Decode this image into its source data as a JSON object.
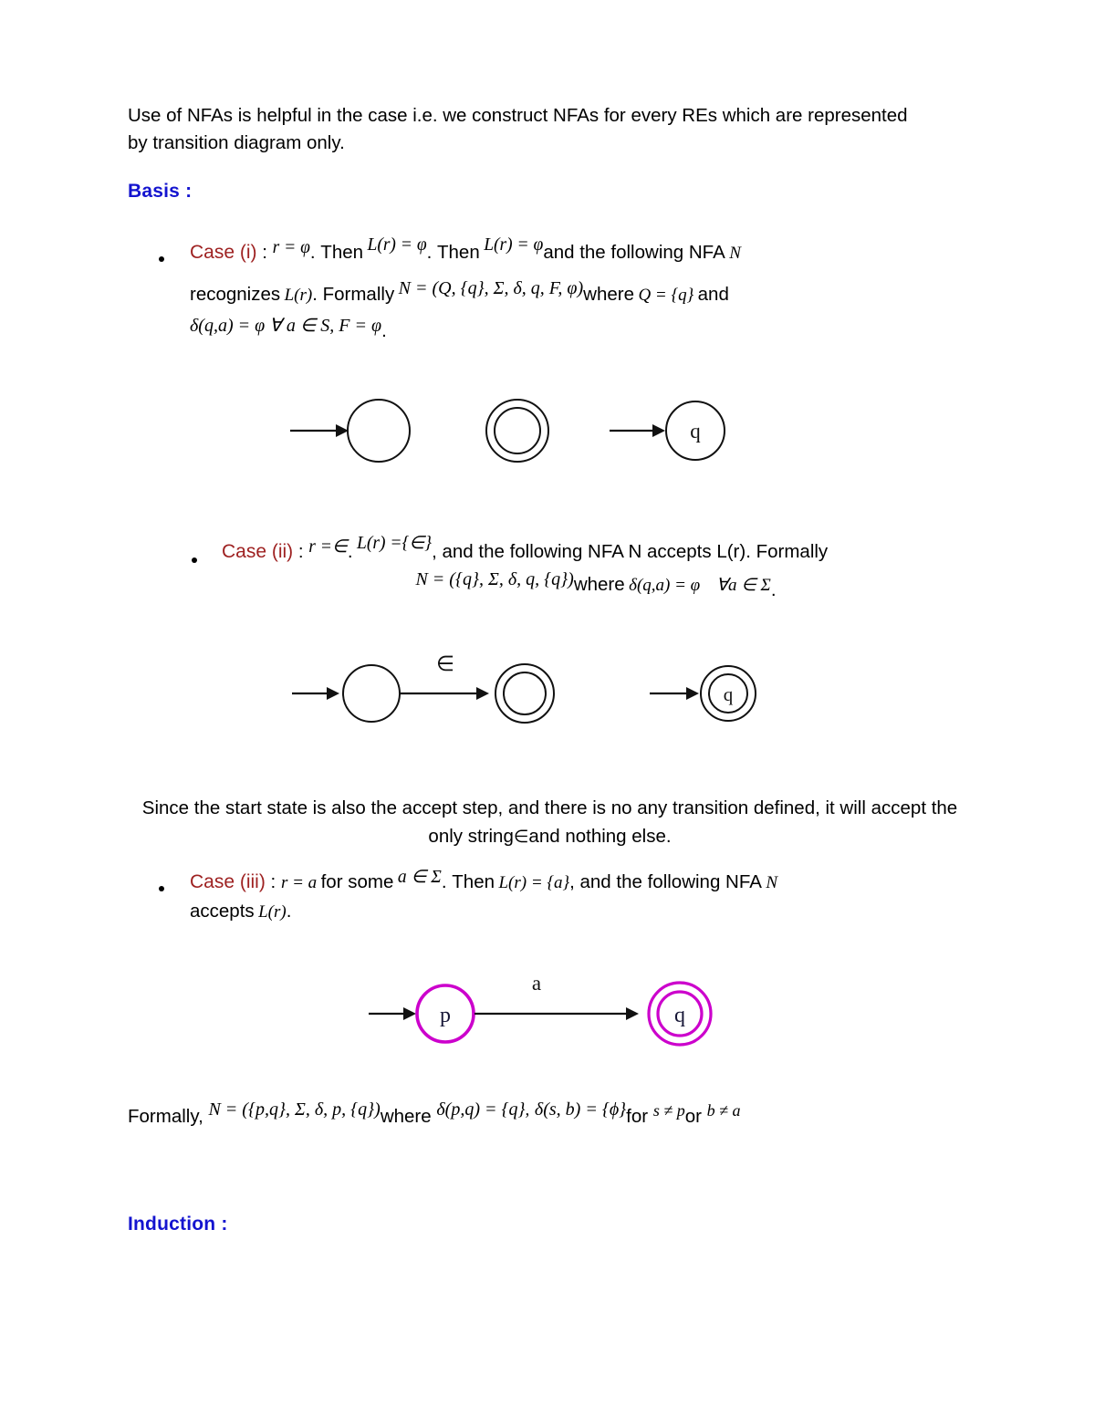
{
  "document": {
    "intro_paragraph": "Use of NFAs is helpful in the case i.e. we construct NFAs for every REs which are represented by transition diagram only.",
    "heading_basis": "Basis :",
    "heading_induction": "Induction :",
    "since_paragraph_line1": "Since the start state is also the accept step, and there is no any transition defined, it will",
    "since_paragraph_line2_a": "accept the only string",
    "since_paragraph_line2_eps": "∈",
    "since_paragraph_line2_b": "and nothing else."
  },
  "case_i": {
    "label": "Case (i)",
    "colon": " : ",
    "eq_r": "r = φ",
    "then1": ". Then",
    "eq_lr1": "L(r) = φ",
    "then2": ". Then",
    "eq_lr2": "L(r) = φ",
    "tail1_a": "and the following NFA",
    "tail1_n": "N",
    "line2_a": "recognizes",
    "line2_lr": "L(r)",
    "line2_b": ". Formally",
    "eq_n": "N = (Q, {q}, Σ, δ, q, F, φ)",
    "line2_where": "where",
    "eq_q": "Q = {q}",
    "line2_and": "and",
    "line3": "δ(q,a) = φ ∀ a ∈ S, F = φ",
    "line3_period": "."
  },
  "case_ii": {
    "label": "Case (ii)",
    "colon": " : ",
    "eq_r": "r =∈",
    "dot1": ".",
    "eq_lr": "L(r) ={∈}",
    "tail": ", and the following NFA N accepts L(r). Formally",
    "eq_n": "N = ({q}, Σ, δ, q, {q})",
    "where": "where",
    "eq_delta": "δ(q,a) = φ",
    "eq_forall": "∀a ∈ Σ",
    "period": "."
  },
  "case_iii": {
    "label": "Case (iii)",
    "colon": " : ",
    "eq_r": "r = a",
    "for_some": "for some",
    "eq_mem": "a ∈ Σ",
    "then": ". Then",
    "eq_lr": "L(r) = {a}",
    "tail_a": ", and the following NFA",
    "tail_n": "N",
    "line2_a": "accepts",
    "line2_lr": "L(r)",
    "line2_b": "."
  },
  "formally": {
    "prefix": "Formally,",
    "eq_n": "N = ({p,q}, Σ, δ, p, {q})",
    "where": "where",
    "eq_delta1": "δ(p,q) = {q}",
    "comma": ",",
    "eq_delta2": "δ(s, b) = {ϕ}",
    "for": "for",
    "cond1": "s ≠ p",
    "or": "or",
    "cond2": "b ≠ a"
  },
  "diagrams": {
    "diagram_1": {
      "name": "empty-language-nfa",
      "states": [
        {
          "id": "s1",
          "label": "",
          "accepting": false,
          "start": true
        },
        {
          "id": "s2",
          "label": "",
          "accepting": true,
          "start": false
        },
        {
          "id": "s3",
          "label": "q",
          "accepting": false,
          "start": true
        }
      ],
      "transitions": []
    },
    "diagram_2": {
      "name": "epsilon-language-nfa",
      "states": [
        {
          "id": "s1",
          "label": "",
          "accepting": false,
          "start": true
        },
        {
          "id": "s2",
          "label": "",
          "accepting": true,
          "start": false
        },
        {
          "id": "s3",
          "label": "q",
          "accepting": true,
          "start": true
        }
      ],
      "transitions": [
        {
          "from": "s1",
          "to": "s2",
          "label": "∈"
        }
      ]
    },
    "diagram_3": {
      "name": "single-symbol-nfa",
      "color": "#cc00cc",
      "states": [
        {
          "id": "p",
          "label": "p",
          "accepting": false,
          "start": true
        },
        {
          "id": "q",
          "label": "q",
          "accepting": true,
          "start": false
        }
      ],
      "transitions": [
        {
          "from": "p",
          "to": "q",
          "label": "a"
        }
      ]
    }
  },
  "colors": {
    "heading_blue": "#1414cf",
    "case_red": "#9e2121",
    "diagram_magenta": "#cc00cc",
    "text_black": "#000000"
  }
}
